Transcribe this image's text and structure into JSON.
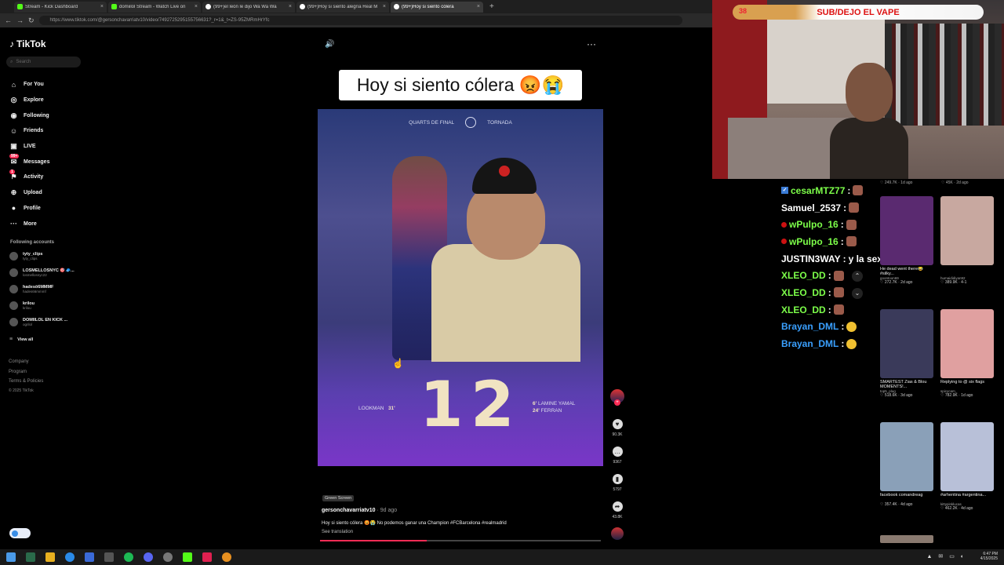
{
  "browser": {
    "tabs": [
      {
        "label": "Stream - Kick Dashboard",
        "icon": "kick-icon",
        "active": false
      },
      {
        "label": "domiilol Stream - Watch Live on",
        "icon": "kick-icon",
        "active": false
      },
      {
        "label": "(99+)el león le dijo Wa Wa Wa",
        "icon": "tiktok-icon",
        "active": false
      },
      {
        "label": "(99+)Hoy si siento alegría Real M",
        "icon": "tiktok-icon",
        "active": false
      },
      {
        "label": "(99+)Hoy si siento cólera",
        "icon": "tiktok-icon",
        "active": true
      }
    ],
    "url": "https://www.tiktok.com/@gersonchavarriatv10/video/7492725295155756631?_r=1&_t=ZS-95ZMRmHrYfc"
  },
  "tiktok": {
    "logo": "TikTok",
    "search_placeholder": "Search",
    "nav": [
      {
        "label": "For You",
        "icon": "home-icon"
      },
      {
        "label": "Explore",
        "icon": "compass-icon"
      },
      {
        "label": "Following",
        "icon": "following-icon"
      },
      {
        "label": "Friends",
        "icon": "friends-icon"
      },
      {
        "label": "LIVE",
        "icon": "live-icon"
      },
      {
        "label": "Messages",
        "icon": "messages-icon",
        "badge": "99+"
      },
      {
        "label": "Activity",
        "icon": "activity-icon",
        "badge": "1"
      },
      {
        "label": "Upload",
        "icon": "upload-icon"
      },
      {
        "label": "Profile",
        "icon": "profile-icon"
      },
      {
        "label": "More",
        "icon": "more-icon"
      }
    ],
    "following_header": "Following accounts",
    "following": [
      {
        "name": "tyty_clips",
        "handle": "tyty_clips"
      },
      {
        "name": "LOSMELLOSNYC 🎯🧢...",
        "handle": "losmellosnyc22"
      },
      {
        "name": "hadesö6MMMF",
        "handle": "hades66mmmf"
      },
      {
        "name": "krilou",
        "handle": "krilou"
      },
      {
        "name": "DOMIILOL EN KICK ...",
        "handle": "ogrilol"
      }
    ],
    "view_all": "View all",
    "footer": [
      "Company",
      "Program",
      "Terms & Policies",
      "© 2025 TikTok"
    ]
  },
  "video": {
    "caption": "Hoy si siento cólera 😡😭",
    "top_left": "QUARTS DE FINAL",
    "top_right": "TORNADA",
    "score_left": "1",
    "score_right": "2",
    "scorer_left": "LOOKMAN",
    "scorer_left_min": "31'",
    "scorer_right_1": "LAMINE YAMAL",
    "scorer_right_2": "FERRAN",
    "scorer_right_min1": "6'",
    "scorer_right_min2": "24'",
    "green_screen": "Green Screen",
    "author": "gersonchavarriatv10",
    "age": "· 9d ago",
    "description": "Hoy si siento cólera 😡😭 No podemos ganar una Champion #FCBarcelona #realmadrid",
    "see_translation": "See translation",
    "likes": "90.3K",
    "comments": "9367",
    "saves": "5797",
    "shares": "43.8K",
    "progress": 0.38
  },
  "stream": {
    "sub_count": "38",
    "sub_goal": "SUB/DEJO EL VAPE",
    "chat": [
      {
        "user": "cesarMTZ77",
        "color": "#7dff4a",
        "badge": true,
        "emote": true
      },
      {
        "user": "Samuel_2537",
        "color": "#ffffff",
        "emote": true
      },
      {
        "user": "wPulpo_16",
        "color": "#7dff4a",
        "dot": true,
        "emote": true
      },
      {
        "user": "wPulpo_16",
        "color": "#7dff4a",
        "dot": true,
        "emote": true
      },
      {
        "user": "JUSTIN3WAY",
        "color": "#ffffff",
        "message": "y la sexta ?"
      },
      {
        "user": "XLEO_DD",
        "color": "#7dff4a",
        "emote": true
      },
      {
        "user": "XLEO_DD",
        "color": "#7dff4a",
        "emote": true
      },
      {
        "user": "XLEO_DD",
        "color": "#7dff4a",
        "emote": true
      },
      {
        "user": "Brayan_DML",
        "color": "#3aa0ff",
        "emoji": true
      },
      {
        "user": "Brayan_DML",
        "color": "#3aa0ff",
        "emoji": true
      }
    ]
  },
  "grid": {
    "top_left": "♡ 249.7K · 1d ago",
    "top_right": "♡ 45K · 2d ago",
    "cards": [
      {
        "title": "He dead went there😂 #silky...",
        "author": "goontoon69",
        "stats": "♡ 272.7K · 2d ago",
        "thumb": "#5a2a70"
      },
      {
        "title": "",
        "author": "humaididiyan92",
        "stats": "♡ 389.9K · 4-1",
        "thumb": "#c8a8a0"
      },
      {
        "title": "SMARTEST Zias & Blou MOMENTS!...",
        "author": "top5_plug",
        "stats": "♡ 518.6K · 3d ago",
        "thumb": "#3a3a5a"
      },
      {
        "title": "Replying to @ six flags",
        "author": "spicycam_",
        "stats": "♡ 782.9K · 1d ago",
        "thumb": "#e0a0a0"
      },
      {
        "title": "facebook comandreag",
        "author": "",
        "stats": "♡ 357.4K · 4d ago",
        "thumb": "#8aa0b8"
      },
      {
        "title": "#arhentina #argentina...",
        "author": "kittypinklucas",
        "stats": "♡ 462.2K · 4d ago",
        "thumb": "#b8c0d8"
      }
    ]
  },
  "taskbar": {
    "time": "6:47 PM",
    "date": "4/15/2025"
  }
}
